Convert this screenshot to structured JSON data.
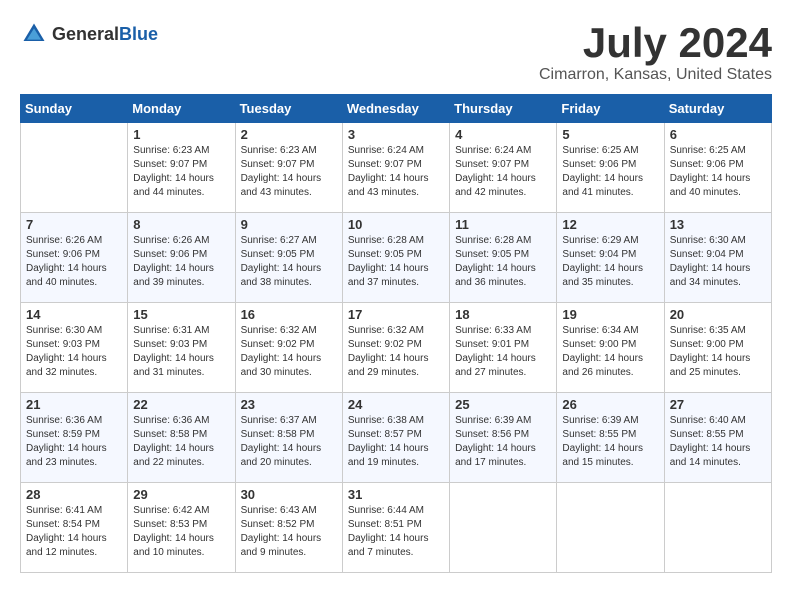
{
  "header": {
    "logo_general": "General",
    "logo_blue": "Blue",
    "month_year": "July 2024",
    "location": "Cimarron, Kansas, United States"
  },
  "days_of_week": [
    "Sunday",
    "Monday",
    "Tuesday",
    "Wednesday",
    "Thursday",
    "Friday",
    "Saturday"
  ],
  "weeks": [
    [
      {
        "day": "",
        "sunrise": "",
        "sunset": "",
        "daylight": "",
        "empty": true
      },
      {
        "day": "1",
        "sunrise": "Sunrise: 6:23 AM",
        "sunset": "Sunset: 9:07 PM",
        "daylight": "Daylight: 14 hours and 44 minutes."
      },
      {
        "day": "2",
        "sunrise": "Sunrise: 6:23 AM",
        "sunset": "Sunset: 9:07 PM",
        "daylight": "Daylight: 14 hours and 43 minutes."
      },
      {
        "day": "3",
        "sunrise": "Sunrise: 6:24 AM",
        "sunset": "Sunset: 9:07 PM",
        "daylight": "Daylight: 14 hours and 43 minutes."
      },
      {
        "day": "4",
        "sunrise": "Sunrise: 6:24 AM",
        "sunset": "Sunset: 9:07 PM",
        "daylight": "Daylight: 14 hours and 42 minutes."
      },
      {
        "day": "5",
        "sunrise": "Sunrise: 6:25 AM",
        "sunset": "Sunset: 9:06 PM",
        "daylight": "Daylight: 14 hours and 41 minutes."
      },
      {
        "day": "6",
        "sunrise": "Sunrise: 6:25 AM",
        "sunset": "Sunset: 9:06 PM",
        "daylight": "Daylight: 14 hours and 40 minutes."
      }
    ],
    [
      {
        "day": "7",
        "sunrise": "Sunrise: 6:26 AM",
        "sunset": "Sunset: 9:06 PM",
        "daylight": "Daylight: 14 hours and 40 minutes."
      },
      {
        "day": "8",
        "sunrise": "Sunrise: 6:26 AM",
        "sunset": "Sunset: 9:06 PM",
        "daylight": "Daylight: 14 hours and 39 minutes."
      },
      {
        "day": "9",
        "sunrise": "Sunrise: 6:27 AM",
        "sunset": "Sunset: 9:05 PM",
        "daylight": "Daylight: 14 hours and 38 minutes."
      },
      {
        "day": "10",
        "sunrise": "Sunrise: 6:28 AM",
        "sunset": "Sunset: 9:05 PM",
        "daylight": "Daylight: 14 hours and 37 minutes."
      },
      {
        "day": "11",
        "sunrise": "Sunrise: 6:28 AM",
        "sunset": "Sunset: 9:05 PM",
        "daylight": "Daylight: 14 hours and 36 minutes."
      },
      {
        "day": "12",
        "sunrise": "Sunrise: 6:29 AM",
        "sunset": "Sunset: 9:04 PM",
        "daylight": "Daylight: 14 hours and 35 minutes."
      },
      {
        "day": "13",
        "sunrise": "Sunrise: 6:30 AM",
        "sunset": "Sunset: 9:04 PM",
        "daylight": "Daylight: 14 hours and 34 minutes."
      }
    ],
    [
      {
        "day": "14",
        "sunrise": "Sunrise: 6:30 AM",
        "sunset": "Sunset: 9:03 PM",
        "daylight": "Daylight: 14 hours and 32 minutes."
      },
      {
        "day": "15",
        "sunrise": "Sunrise: 6:31 AM",
        "sunset": "Sunset: 9:03 PM",
        "daylight": "Daylight: 14 hours and 31 minutes."
      },
      {
        "day": "16",
        "sunrise": "Sunrise: 6:32 AM",
        "sunset": "Sunset: 9:02 PM",
        "daylight": "Daylight: 14 hours and 30 minutes."
      },
      {
        "day": "17",
        "sunrise": "Sunrise: 6:32 AM",
        "sunset": "Sunset: 9:02 PM",
        "daylight": "Daylight: 14 hours and 29 minutes."
      },
      {
        "day": "18",
        "sunrise": "Sunrise: 6:33 AM",
        "sunset": "Sunset: 9:01 PM",
        "daylight": "Daylight: 14 hours and 27 minutes."
      },
      {
        "day": "19",
        "sunrise": "Sunrise: 6:34 AM",
        "sunset": "Sunset: 9:00 PM",
        "daylight": "Daylight: 14 hours and 26 minutes."
      },
      {
        "day": "20",
        "sunrise": "Sunrise: 6:35 AM",
        "sunset": "Sunset: 9:00 PM",
        "daylight": "Daylight: 14 hours and 25 minutes."
      }
    ],
    [
      {
        "day": "21",
        "sunrise": "Sunrise: 6:36 AM",
        "sunset": "Sunset: 8:59 PM",
        "daylight": "Daylight: 14 hours and 23 minutes."
      },
      {
        "day": "22",
        "sunrise": "Sunrise: 6:36 AM",
        "sunset": "Sunset: 8:58 PM",
        "daylight": "Daylight: 14 hours and 22 minutes."
      },
      {
        "day": "23",
        "sunrise": "Sunrise: 6:37 AM",
        "sunset": "Sunset: 8:58 PM",
        "daylight": "Daylight: 14 hours and 20 minutes."
      },
      {
        "day": "24",
        "sunrise": "Sunrise: 6:38 AM",
        "sunset": "Sunset: 8:57 PM",
        "daylight": "Daylight: 14 hours and 19 minutes."
      },
      {
        "day": "25",
        "sunrise": "Sunrise: 6:39 AM",
        "sunset": "Sunset: 8:56 PM",
        "daylight": "Daylight: 14 hours and 17 minutes."
      },
      {
        "day": "26",
        "sunrise": "Sunrise: 6:39 AM",
        "sunset": "Sunset: 8:55 PM",
        "daylight": "Daylight: 14 hours and 15 minutes."
      },
      {
        "day": "27",
        "sunrise": "Sunrise: 6:40 AM",
        "sunset": "Sunset: 8:55 PM",
        "daylight": "Daylight: 14 hours and 14 minutes."
      }
    ],
    [
      {
        "day": "28",
        "sunrise": "Sunrise: 6:41 AM",
        "sunset": "Sunset: 8:54 PM",
        "daylight": "Daylight: 14 hours and 12 minutes."
      },
      {
        "day": "29",
        "sunrise": "Sunrise: 6:42 AM",
        "sunset": "Sunset: 8:53 PM",
        "daylight": "Daylight: 14 hours and 10 minutes."
      },
      {
        "day": "30",
        "sunrise": "Sunrise: 6:43 AM",
        "sunset": "Sunset: 8:52 PM",
        "daylight": "Daylight: 14 hours and 9 minutes."
      },
      {
        "day": "31",
        "sunrise": "Sunrise: 6:44 AM",
        "sunset": "Sunset: 8:51 PM",
        "daylight": "Daylight: 14 hours and 7 minutes."
      },
      {
        "day": "",
        "sunrise": "",
        "sunset": "",
        "daylight": "",
        "empty": true
      },
      {
        "day": "",
        "sunrise": "",
        "sunset": "",
        "daylight": "",
        "empty": true
      },
      {
        "day": "",
        "sunrise": "",
        "sunset": "",
        "daylight": "",
        "empty": true
      }
    ]
  ]
}
